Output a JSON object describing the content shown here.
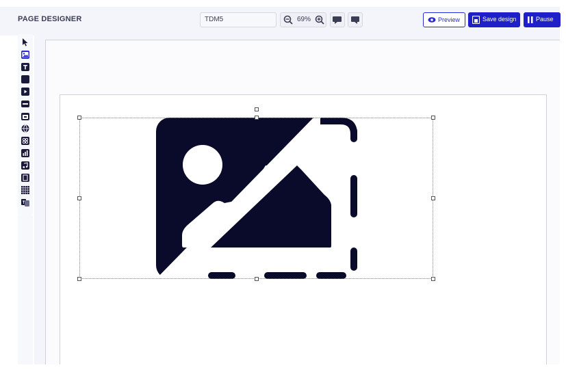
{
  "header": {
    "page_title": "PAGE DESIGNER",
    "document_name": "TDM5",
    "zoom_level": "69%",
    "preview_label": "Preview",
    "save_label": "Save design",
    "pause_label": "Pause"
  },
  "toolbar_tools": [
    "pointer-icon",
    "image-tool-icon",
    "text-tool-icon",
    "shape-tool-icon",
    "video-tool-icon",
    "ticker-tool-icon",
    "calendar-tool-icon",
    "web-tool-icon",
    "qr-tool-icon",
    "chart-tool-icon",
    "audio-tool-icon",
    "media-tool-icon",
    "grid-tool-icon",
    "translate-tool-icon"
  ],
  "colors": {
    "accent": "#1f1fc9",
    "icon_fill": "#0a0a2a",
    "toolbar_bg": "#f4f5fa"
  }
}
